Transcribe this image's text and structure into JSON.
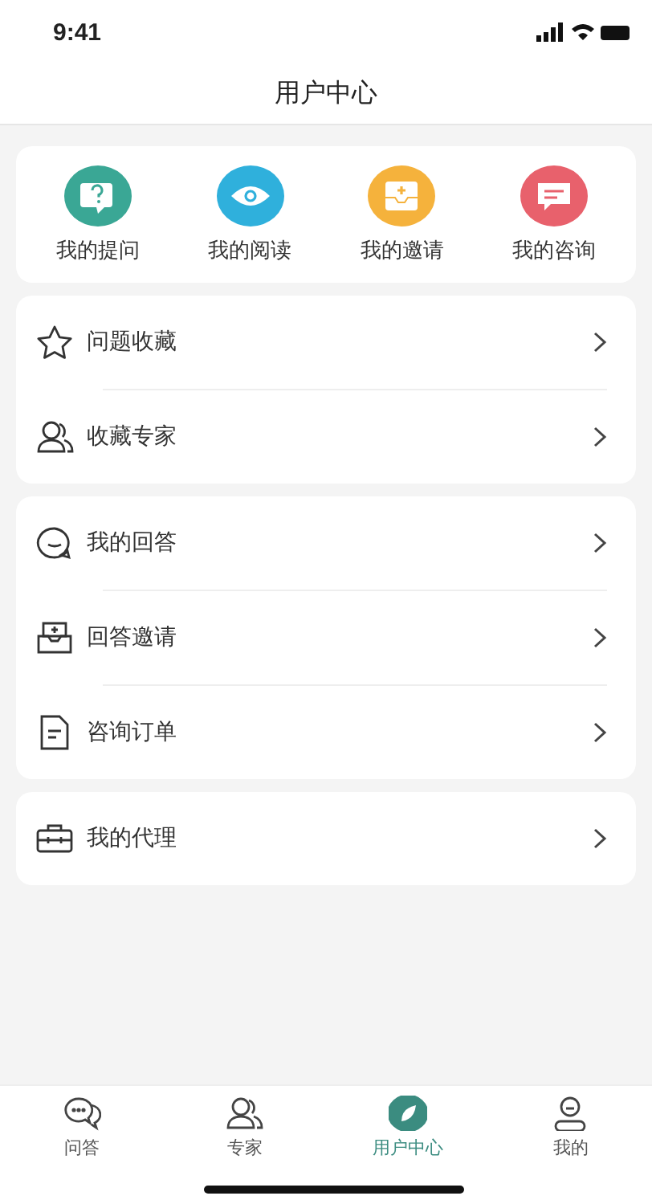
{
  "status_bar": {
    "time": "9:41"
  },
  "header": {
    "title": "用户中心"
  },
  "shortcuts": [
    {
      "label": "我的提问",
      "kind": "question",
      "color": "#3aa795"
    },
    {
      "label": "我的阅读",
      "kind": "eye",
      "color": "#2fb0dc"
    },
    {
      "label": "我的邀请",
      "kind": "inbox",
      "color": "#f5b23c"
    },
    {
      "label": "我的咨询",
      "kind": "message",
      "color": "#e8616c"
    }
  ],
  "menu_groups": [
    {
      "items": [
        {
          "label": "问题收藏",
          "kind": "star"
        },
        {
          "label": "收藏专家",
          "kind": "people"
        }
      ]
    },
    {
      "items": [
        {
          "label": "我的回答",
          "kind": "bubble"
        },
        {
          "label": "回答邀请",
          "kind": "tray"
        },
        {
          "label": "咨询订单",
          "kind": "document"
        }
      ]
    },
    {
      "items": [
        {
          "label": "我的代理",
          "kind": "briefcase"
        }
      ]
    }
  ],
  "tab_bar": [
    {
      "label": "问答",
      "kind": "chat",
      "selected": false
    },
    {
      "label": "专家",
      "kind": "people",
      "selected": false
    },
    {
      "label": "用户中心",
      "kind": "leaf",
      "selected": true
    },
    {
      "label": "我的",
      "kind": "person",
      "selected": false
    }
  ]
}
